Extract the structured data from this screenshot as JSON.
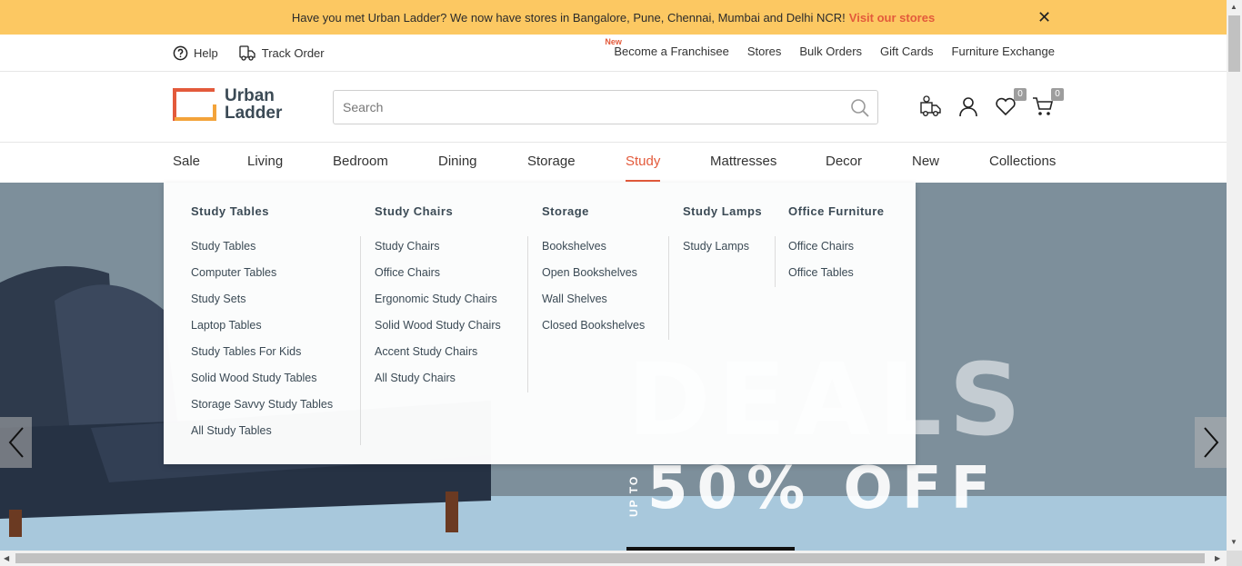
{
  "announcement": {
    "text": "Have you met Urban Ladder? We now have stores in Bangalore, Pune, Chennai, Mumbai and Delhi NCR!",
    "link": "Visit our stores",
    "close": "✕"
  },
  "util_bar": {
    "help": "Help",
    "track_order": "Track Order",
    "new_badge": "New",
    "links": [
      "Become a Franchisee",
      "Stores",
      "Bulk Orders",
      "Gift Cards",
      "Furniture Exchange"
    ]
  },
  "header": {
    "logo_line1": "Urban",
    "logo_line2": "Ladder",
    "search_placeholder": "Search",
    "wishlist_count": "0",
    "cart_count": "0"
  },
  "nav": {
    "items": [
      "Sale",
      "Living",
      "Bedroom",
      "Dining",
      "Storage",
      "Study",
      "Mattresses",
      "Decor",
      "New",
      "Collections"
    ],
    "active": "Study"
  },
  "dropdown": {
    "columns": [
      {
        "title": "Study Tables",
        "items": [
          "Study Tables",
          "Computer Tables",
          "Study Sets",
          "Laptop Tables",
          "Study Tables For Kids",
          "Solid Wood Study Tables",
          "Storage Savvy Study Tables",
          "All Study Tables"
        ]
      },
      {
        "title": "Study Chairs",
        "items": [
          "Study Chairs",
          "Office Chairs",
          "Ergonomic Study Chairs",
          "Solid Wood Study Chairs",
          "Accent Study Chairs",
          "All Study Chairs"
        ]
      },
      {
        "title": "Storage",
        "items": [
          "Bookshelves",
          "Open Bookshelves",
          "Wall Shelves",
          "Closed Bookshelves"
        ]
      },
      {
        "title": "Study Lamps",
        "items": [
          "Study Lamps"
        ]
      },
      {
        "title": "Office Furniture",
        "items": [
          "Office Chairs",
          "Office Tables"
        ]
      }
    ]
  },
  "hero": {
    "headline": "DEALS",
    "subline": "50% OFF",
    "upto": "UP TO"
  },
  "colors": {
    "accent": "#e35a3b",
    "announcement_bg": "#fcc862",
    "text_dark": "#3b4a55"
  }
}
